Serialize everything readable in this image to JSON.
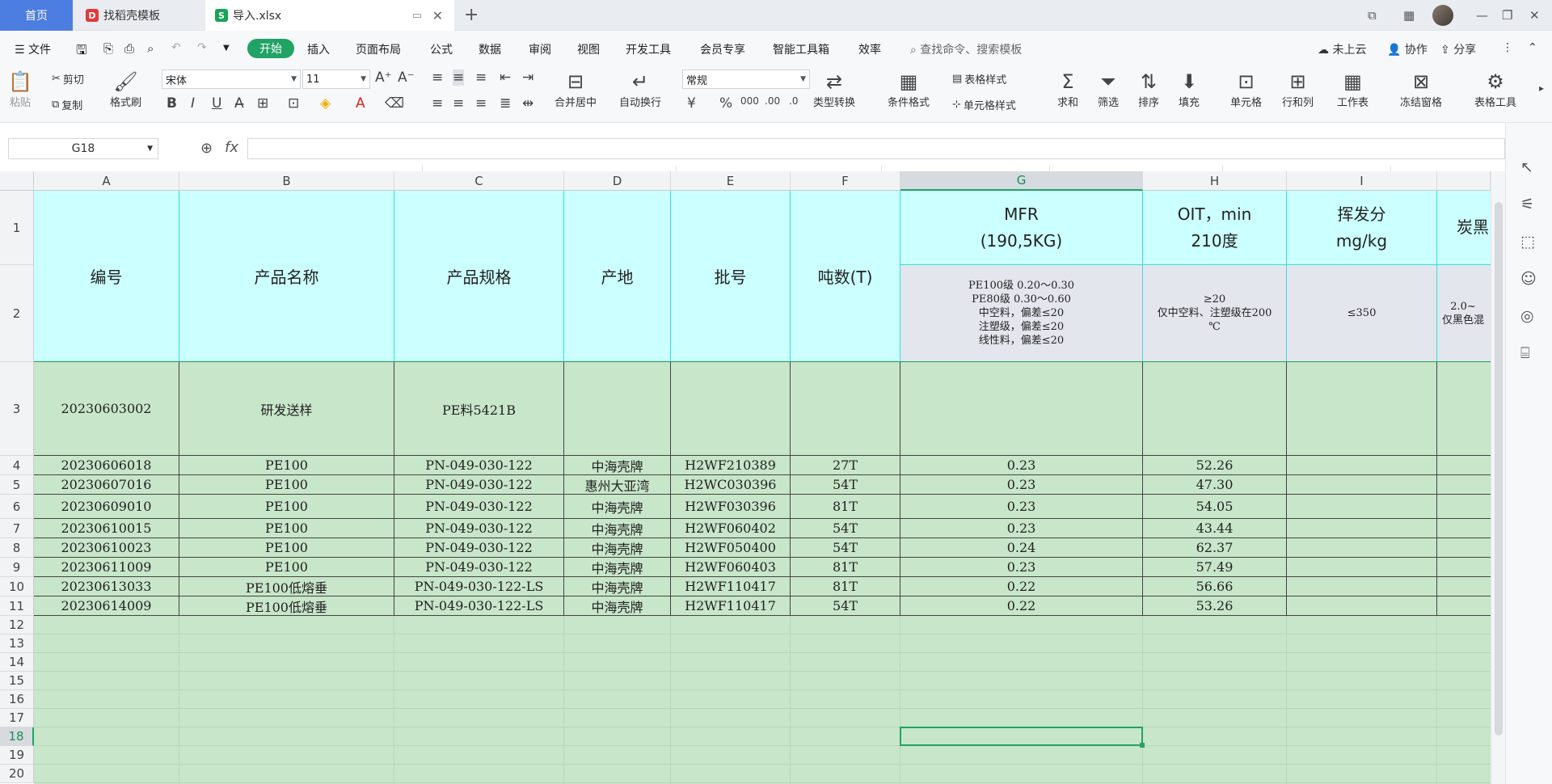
{
  "tabs": {
    "home": "首页",
    "template": "找稻壳模板",
    "file": "导入.xlsx",
    "template_icon": "D",
    "file_icon": "S"
  },
  "window": {
    "controls": [
      "⧉",
      "▦",
      "—",
      "❐",
      "✕"
    ]
  },
  "menu": {
    "file": "文件",
    "start": "开始",
    "items": [
      "插入",
      "页面布局",
      "公式",
      "数据",
      "审阅",
      "视图",
      "开发工具",
      "会员专享",
      "智能工具箱",
      "效率"
    ],
    "search": "查找命令、搜索模板",
    "cloud": "未上云",
    "collab": "协作",
    "share": "分享"
  },
  "ribbon": {
    "paste": "粘贴",
    "cut": "剪切",
    "copy": "复制",
    "format_painter": "格式刷",
    "font_name": "宋体",
    "font_size": "11",
    "merge_center": "合并居中",
    "wrap": "自动换行",
    "number_format": "常规",
    "type_convert": "类型转换",
    "cond_format": "条件格式",
    "table_style": "表格样式",
    "cell_style": "单元格样式",
    "sum": "求和",
    "filter": "筛选",
    "sort": "排序",
    "fill": "填充",
    "cell": "单元格",
    "rowcol": "行和列",
    "worksheet": "工作表",
    "freeze": "冻结窗格",
    "table_tools": "表格工具"
  },
  "formula_bar": {
    "name_box": "G18",
    "formula": ""
  },
  "columns": [
    "A",
    "B",
    "C",
    "D",
    "E",
    "F",
    "G",
    "H",
    "I"
  ],
  "selected_column": "G",
  "selected_row": "18",
  "row_numbers": [
    "1",
    "2",
    "3",
    "4",
    "5",
    "6",
    "7",
    "8",
    "9",
    "10",
    "11",
    "12",
    "13",
    "14",
    "15",
    "16",
    "17",
    "18",
    "19",
    "20"
  ],
  "header": {
    "id": "编号",
    "name": "产品名称",
    "spec": "产品规格",
    "origin": "产地",
    "batch": "批号",
    "tons": "吨数(T)",
    "mfr": "MFR\n(190,5KG)",
    "oit": "OIT，min\n210度",
    "volatile": "挥发分\nmg/kg",
    "carbon": "炭黑"
  },
  "spec_row": {
    "mfr": "PE100级 0.20～0.30\nPE80级 0.30～0.60\n中空料，偏差≤20\n注塑级，偏差≤20\n线性料，偏差≤20",
    "oit": "≥20\n仅中空料、注塑级在200\n℃",
    "volatile": "≤350",
    "carbon": "2.0~\n仅黑色混"
  },
  "rows": [
    {
      "id": "20230603002",
      "name": "研发送样",
      "spec": "PE料5421B",
      "origin": "",
      "batch": "",
      "tons": "",
      "mfr": "",
      "oit": ""
    },
    {
      "id": "20230606018",
      "name": "PE100",
      "spec": "PN-049-030-122",
      "origin": "中海壳牌",
      "batch": "H2WF210389",
      "tons": "27T",
      "mfr": "0.23",
      "oit": "52.26"
    },
    {
      "id": "20230607016",
      "name": "PE100",
      "spec": "PN-049-030-122",
      "origin": "惠州大亚湾",
      "batch": "H2WC030396",
      "tons": "54T",
      "mfr": "0.23",
      "oit": "47.30"
    },
    {
      "id": "20230609010",
      "name": "PE100",
      "spec": "PN-049-030-122",
      "origin": "中海壳牌",
      "batch": "H2WF030396",
      "tons": "81T",
      "mfr": "0.23",
      "oit": "54.05"
    },
    {
      "id": "20230610015",
      "name": "PE100",
      "spec": "PN-049-030-122",
      "origin": "中海壳牌",
      "batch": "H2WF060402",
      "tons": "54T",
      "mfr": "0.23",
      "oit": "43.44"
    },
    {
      "id": "20230610023",
      "name": "PE100",
      "spec": "PN-049-030-122",
      "origin": "中海壳牌",
      "batch": "H2WF050400",
      "tons": "54T",
      "mfr": "0.24",
      "oit": "62.37"
    },
    {
      "id": "20230611009",
      "name": "PE100",
      "spec": "PN-049-030-122",
      "origin": "中海壳牌",
      "batch": "H2WF060403",
      "tons": "81T",
      "mfr": "0.23",
      "oit": "57.49"
    },
    {
      "id": "20230613033",
      "name": "PE100低熔垂",
      "spec": "PN-049-030-122-LS",
      "origin": "中海壳牌",
      "batch": "H2WF110417",
      "tons": "81T",
      "mfr": "0.22",
      "oit": "56.66"
    },
    {
      "id": "20230614009",
      "name": "PE100低熔垂",
      "spec": "PN-049-030-122-LS",
      "origin": "中海壳牌",
      "batch": "H2WF110417",
      "tons": "54T",
      "mfr": "0.22",
      "oit": "53.26"
    }
  ],
  "colors": {
    "header_fill": "#ccffff",
    "spec_fill": "#e4e6ee",
    "data_fill": "#c8e6c9",
    "accent": "#21a366",
    "tab_home": "#4c7de0"
  }
}
